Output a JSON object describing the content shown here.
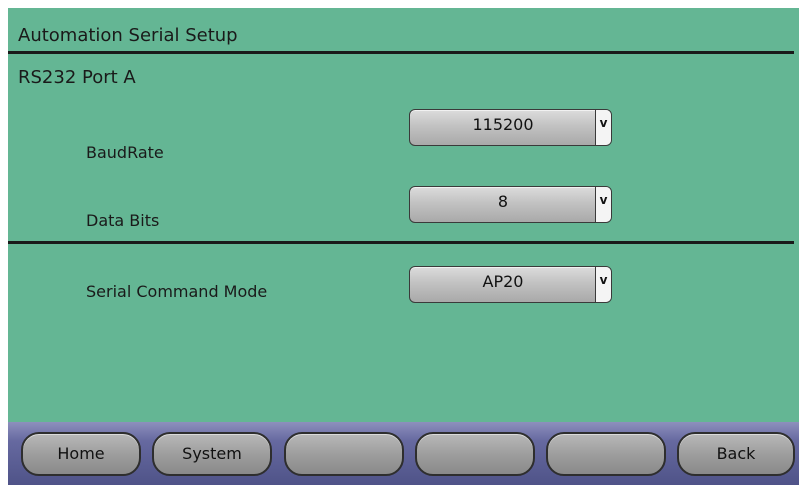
{
  "screen": {
    "title": "Automation Serial Setup",
    "section": "RS232 Port A"
  },
  "fields": [
    {
      "label": "BaudRate",
      "value": "115200"
    },
    {
      "label": "Data Bits",
      "value": "8"
    },
    {
      "label": "Serial Command Mode",
      "value": "AP20"
    }
  ],
  "dropdown_arrow": "v",
  "navbar": {
    "buttons": [
      {
        "label": "Home"
      },
      {
        "label": "System"
      },
      {
        "label": ""
      },
      {
        "label": ""
      },
      {
        "label": ""
      },
      {
        "label": "Back"
      }
    ]
  },
  "colors": {
    "panel_bg": "#64b694",
    "navbar_bg": "#6669a0",
    "button_bg": "#a9a9a9"
  }
}
